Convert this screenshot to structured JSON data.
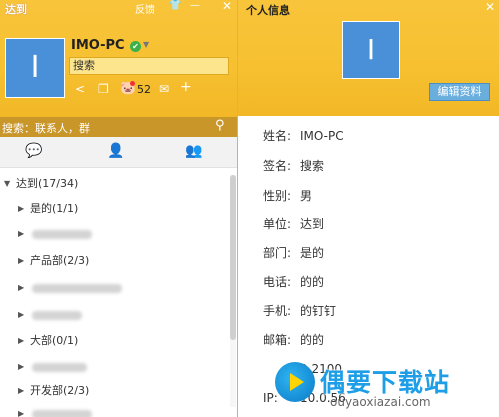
{
  "left": {
    "title": "达到",
    "toolbar": {
      "feedback": "反馈",
      "shirt_icon": "shirt-icon",
      "minimize": "—",
      "close": "✕"
    },
    "profile": {
      "avatar_letter": "I",
      "name": "IMO-PC",
      "status_icon": "online-check-icon",
      "signature": "搜索",
      "coins": "52"
    },
    "search_placeholder": "搜索：联系人，群",
    "tabs": [
      "messages",
      "contacts",
      "groups"
    ],
    "tree": {
      "root": "达到(17/34)",
      "items": [
        {
          "label": "是的(1/1)",
          "blurred": false
        },
        {
          "label": "",
          "blurred": true
        },
        {
          "label": "产品部(2/3)",
          "blurred": false
        },
        {
          "label": "",
          "blurred": true
        },
        {
          "label": "",
          "blurred": true
        },
        {
          "label": "大部(0/1)",
          "blurred": false
        },
        {
          "label": "",
          "blurred": true
        },
        {
          "label": "开发部(2/3)",
          "blurred": false
        },
        {
          "label": "",
          "blurred": true
        }
      ]
    }
  },
  "right": {
    "title": "个人信息",
    "close": "✕",
    "avatar_letter": "I",
    "edit_button": "编辑资料",
    "fields": [
      {
        "key": "姓名:",
        "value": "IMO-PC"
      },
      {
        "key": "签名:",
        "value": "搜索"
      },
      {
        "key": "性别:",
        "value": "男"
      },
      {
        "key": "单位:",
        "value": "达到"
      },
      {
        "key": "部门:",
        "value": "是的"
      },
      {
        "key": "电话:",
        "value": "的的"
      },
      {
        "key": "手机:",
        "value": "的钉钉"
      },
      {
        "key": "邮箱:",
        "value": "的的"
      },
      {
        "key": "",
        "value": "2.2100"
      },
      {
        "key": "IP:",
        "value": "10.0.56"
      }
    ]
  },
  "watermark": {
    "text": "偶要下载站",
    "url": "ouyaoxiazai.com"
  }
}
